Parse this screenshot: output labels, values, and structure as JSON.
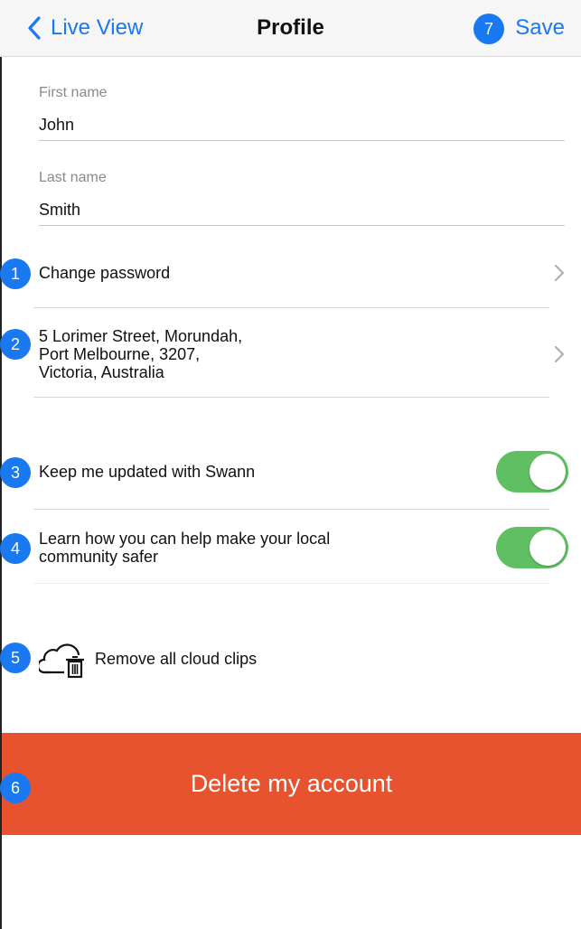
{
  "nav": {
    "back_label": "Live View",
    "title": "Profile",
    "save_label": "Save"
  },
  "form": {
    "first_name_label": "First name",
    "first_name_value": "John",
    "last_name_label": "Last name",
    "last_name_value": "Smith"
  },
  "rows": {
    "change_password": "Change password",
    "address_line1": "5 Lorimer Street, Morundah,",
    "address_line2": "Port Melbourne, 3207,",
    "address_line3": "Victoria, Australia",
    "keep_updated": "Keep me updated with Swann",
    "community_line1": "Learn how you can help make your local",
    "community_line2": "community safer",
    "remove_clips": "Remove all cloud clips",
    "delete_account": "Delete my account"
  },
  "badges": [
    "1",
    "2",
    "3",
    "4",
    "5",
    "6",
    "7"
  ],
  "toggles": {
    "keep_updated_on": true,
    "community_on": true
  },
  "colors": {
    "accent": "#1a78f0",
    "toggle_on": "#5fbf62",
    "danger": "#e8532f"
  },
  "icons": {
    "back": "chevron-left-icon",
    "row": "chevron-right-icon",
    "cloud_delete": "cloud-trash-icon"
  }
}
